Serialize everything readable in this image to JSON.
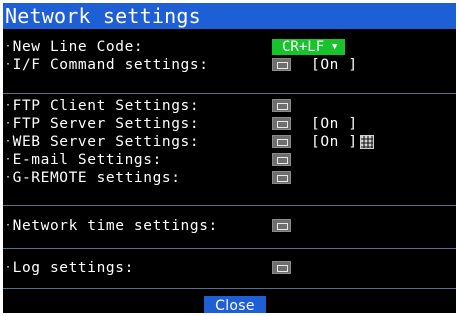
{
  "title": "Network settings",
  "bullet": "·",
  "rows": {
    "new_line_code": {
      "label": "New Line Code:",
      "value": "CR+LF",
      "arrow": "▼"
    },
    "if_command": {
      "label": "I/F Command settings:",
      "value": "[On ]"
    },
    "ftp_client": {
      "label": "FTP Client Settings:"
    },
    "ftp_server": {
      "label": "FTP Server Settings:",
      "value": "[On ]"
    },
    "web_server": {
      "label": "WEB Server Settings:",
      "value": "[On ]"
    },
    "email": {
      "label": "E-mail Settings:"
    },
    "g_remote": {
      "label": "G-REMOTE settings:"
    },
    "network_time": {
      "label": "Network time settings:"
    },
    "log": {
      "label": "Log settings:"
    }
  },
  "close_label": "Close",
  "colors": {
    "background": "#000000",
    "title_bar": "#1f5fd6",
    "selector_green": "#17c42c",
    "divider": "#5b6f8f",
    "icon_gray": "#6e6e6e"
  },
  "icons": {
    "settings_button": "keyboard-icon",
    "web_server_extra": "qr-code-icon"
  }
}
